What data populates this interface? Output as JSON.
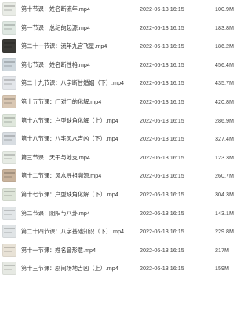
{
  "files": [
    {
      "name": "第十节课：姓名断流年.mp4",
      "date": "2022-06-13 16:15",
      "size": "100.9M",
      "thumb_color": "#e9ece6"
    },
    {
      "name": "第一节课：总纪的起源.mp4",
      "date": "2022-06-13 16:15",
      "size": "183.8M",
      "thumb_color": "#dfe8e2"
    },
    {
      "name": "第二十一节课：流年九宫飞星.mp4",
      "date": "2022-06-13 16:15",
      "size": "186.2M",
      "thumb_color": "#3b3a36"
    },
    {
      "name": "第七节课：姓名断性格.mp4",
      "date": "2022-06-13 16:15",
      "size": "456.4M",
      "thumb_color": "#cfd8de"
    },
    {
      "name": "第二十九节课：八字断甘婚姻（下）.mp4",
      "date": "2022-06-13 16:15",
      "size": "435.7M",
      "thumb_color": "#e3e6ea"
    },
    {
      "name": "第十五节课：门对门的化解.mp4",
      "date": "2022-06-13 16:15",
      "size": "420.8M",
      "thumb_color": "#d9c7b3"
    },
    {
      "name": "第十六节课：户型缺角化解（上）.mp4",
      "date": "2022-06-13 16:15",
      "size": "286.9M",
      "thumb_color": "#dfe7dc"
    },
    {
      "name": "第十八节课：八宅风水吉凶（下）.mp4",
      "date": "2022-06-13 16:15",
      "size": "327.4M",
      "thumb_color": "#d8dde2"
    },
    {
      "name": "第三节课：天干与地支.mp4",
      "date": "2022-06-13 16:15",
      "size": "123.3M",
      "thumb_color": "#e6ebe4"
    },
    {
      "name": "第十二节课：风水寻祖溯源.mp4",
      "date": "2022-06-13 16:15",
      "size": "260.7M",
      "thumb_color": "#c9b39c"
    },
    {
      "name": "第十七节课：户型缺角化解（下）.mp4",
      "date": "2022-06-13 16:15",
      "size": "304.3M",
      "thumb_color": "#dde4d8"
    },
    {
      "name": "第二节课：阴阳与八卦.mp4",
      "date": "2022-06-13 16:15",
      "size": "143.1M",
      "thumb_color": "#e2e6e8"
    },
    {
      "name": "第二十四节课：八字基础知识（下）.mp4",
      "date": "2022-06-13 16:15",
      "size": "229.8M",
      "thumb_color": "#e0e4e6"
    },
    {
      "name": "第十一节课：姓名音形意.mp4",
      "date": "2022-06-13 16:15",
      "size": "217M",
      "thumb_color": "#e8e2d6"
    },
    {
      "name": "第十三节课：剧间场地吉凶（上）.mp4",
      "date": "2022-06-13 16:15",
      "size": "159M",
      "thumb_color": "#e6e9e3"
    }
  ]
}
